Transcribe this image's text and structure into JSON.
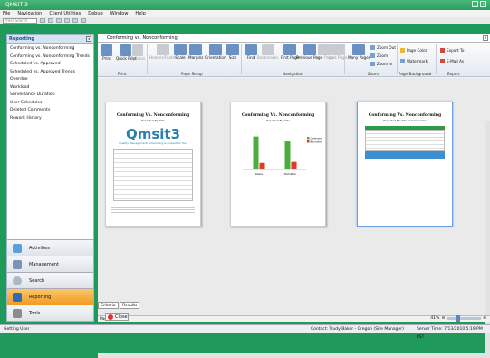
{
  "window": {
    "title": "QMSIT 3"
  },
  "menu": [
    "File",
    "Navigation",
    "Client Utilities",
    "Debug",
    "Window",
    "Help"
  ],
  "search": {
    "placeholder": "Press Search Here"
  },
  "left_panel": {
    "title": "Reporting",
    "items": [
      "Conforming vs. Nonconforming",
      "Conforming vs. Nonconforming Trends",
      "Scheduled vs. Approved",
      "Scheduled vs. Approved Trends",
      "Overdue",
      "Workload",
      "Surveillance Duration",
      "User Schedules",
      "Deleted Comments",
      "Rework History"
    ]
  },
  "nav_buttons": [
    "Activities",
    "Management",
    "Search",
    "Reporting",
    "Tools"
  ],
  "doc_tab": {
    "title": "Conforming vs. Nonconforming"
  },
  "ribbon": {
    "print": {
      "buttons": [
        "Print",
        "Quick Print",
        "Options"
      ],
      "label": "Print"
    },
    "page_setup": {
      "buttons": [
        "Header/Footer",
        "Scale",
        "Margins",
        "Orientation",
        "Size"
      ],
      "label": "Page Setup"
    },
    "navigation": {
      "buttons": [
        "Find",
        "Bookmarks",
        "First Page",
        "Previous Page",
        "Next Page",
        "Last Page"
      ],
      "label": "Navigation"
    },
    "zoom": {
      "buttons": [
        "Many Pages",
        "Zoom Out",
        "Zoom",
        "Zoom In"
      ],
      "label": "Zoom"
    },
    "page_background": {
      "buttons": [
        "Page Color",
        "Watermark"
      ],
      "label": "Page Background"
    },
    "export": {
      "buttons": [
        "Export To",
        "E-Mail As"
      ],
      "label": "Export"
    }
  },
  "pages": [
    {
      "title": "Conforming Vs. Nonconforming",
      "subtitle": "Reported By: Site",
      "logo": "Qmsit3",
      "tagline": "Quality Management Scheduling & Inspection Tool"
    },
    {
      "title": "Conforming Vs. Nonconforming",
      "subtitle": "Reported By: Site",
      "legend": [
        "Conforming",
        "Nonconforming"
      ],
      "categories": [
        "Blaine",
        "Hamilton"
      ]
    },
    {
      "title": "Conforming Vs. Nonconforming",
      "subtitle": "Reported By: Site and Inspector"
    }
  ],
  "chart_data": {
    "type": "bar",
    "categories": [
      "Blaine",
      "Hamilton"
    ],
    "series": [
      {
        "name": "Conforming",
        "values": [
          10,
          8.5
        ]
      },
      {
        "name": "Nonconforming",
        "values": [
          2,
          2.3
        ]
      }
    ],
    "ylim": [
      0,
      11
    ],
    "colors": {
      "Conforming": "#4cae3a",
      "Nonconforming": "#e03a2a"
    }
  },
  "page_indicator": "Page 3 of 3",
  "zoom_level": "41%",
  "bottom_tabs": [
    "Criteria",
    "Results"
  ],
  "close_label": "Close",
  "status": {
    "left": "Getting User",
    "contact": "Contact:  Trudy Baker - Oregon (Site Manager)",
    "server": "Server Time: 7/13/2010 5:19 PM PST"
  }
}
